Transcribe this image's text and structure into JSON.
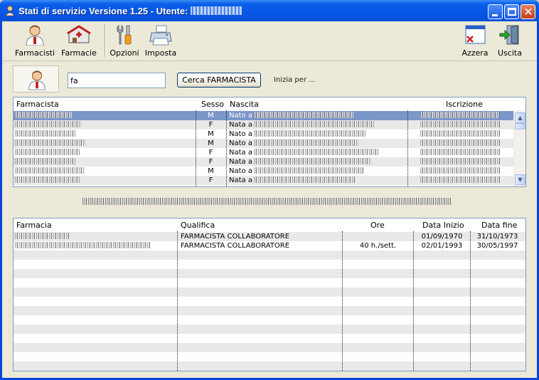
{
  "window": {
    "title": "Stati di servizio Versione 1.25 - Utente:",
    "title_icon": "user-icon"
  },
  "toolbar": {
    "farmacisti": {
      "label": "Farmacisti",
      "icon": "pharmacist-icon"
    },
    "farmacie": {
      "label": "Farmacie",
      "icon": "pharmacy-icon"
    },
    "opzioni": {
      "label": "Opzioni",
      "icon": "tools-icon"
    },
    "imposta": {
      "label": "Imposta",
      "icon": "printer-icon"
    },
    "azzera": {
      "label": "Azzera",
      "icon": "clear-window-icon"
    },
    "uscita": {
      "label": "Uscita",
      "icon": "exit-door-icon"
    }
  },
  "search": {
    "value": "fa",
    "button_label": "Cerca FARMACISTA",
    "hint": "Inizia per ..."
  },
  "pharmacists": {
    "headers": [
      "Farmacista",
      "Sesso",
      "Nascita",
      "Iscrizione"
    ],
    "rows": [
      {
        "sesso": "M",
        "nascita": "Nato a",
        "selected": true
      },
      {
        "sesso": "F",
        "nascita": "Nata a"
      },
      {
        "sesso": "M",
        "nascita": "Nato a"
      },
      {
        "sesso": "M",
        "nascita": "Nato a"
      },
      {
        "sesso": "F",
        "nascita": "Nata a"
      },
      {
        "sesso": "F",
        "nascita": "Nata a"
      },
      {
        "sesso": "M",
        "nascita": "Nato a"
      },
      {
        "sesso": "F",
        "nascita": "Nata a"
      }
    ]
  },
  "services": {
    "headers": [
      "Farmacia",
      "Qualifica",
      "Ore",
      "Data Inizio",
      "Data fine"
    ],
    "rows": [
      {
        "qualifica": "FARMACISTA COLLABORATORE",
        "ore": "",
        "inizio": "01/09/1970",
        "fine": "31/10/1973"
      },
      {
        "qualifica": "FARMACISTA COLLABORATORE",
        "ore": "40 h./sett.",
        "inizio": "02/01/1993",
        "fine": "30/05/1997"
      }
    ]
  },
  "colors": {
    "titlebar": "#0656e6",
    "selection": "#7b96c8",
    "window_bg": "#ece9d8"
  }
}
